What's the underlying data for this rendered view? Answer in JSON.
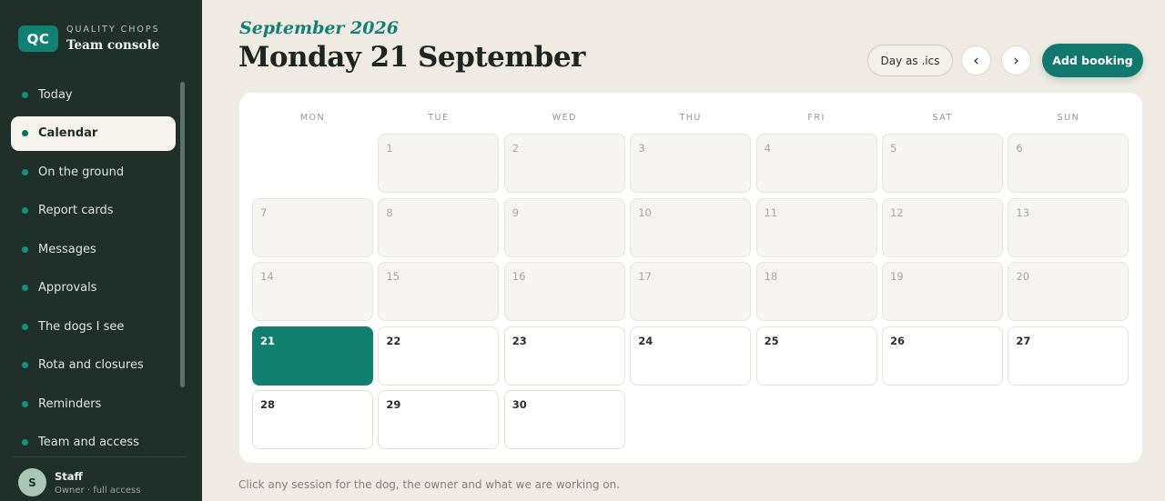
{
  "brand": {
    "logo": "QC",
    "kicker": "QUALITY CHOPS",
    "title": "Team console"
  },
  "nav": [
    {
      "label": "Today",
      "active": false
    },
    {
      "label": "Calendar",
      "active": true
    },
    {
      "label": "On the ground",
      "active": false
    },
    {
      "label": "Report cards",
      "active": false
    },
    {
      "label": "Messages",
      "active": false
    },
    {
      "label": "Approvals",
      "active": false
    },
    {
      "label": "The dogs I see",
      "active": false
    },
    {
      "label": "Rota and closures",
      "active": false
    },
    {
      "label": "Reminders",
      "active": false
    },
    {
      "label": "Team and access",
      "active": false
    }
  ],
  "user": {
    "initial": "S",
    "name": "Staff",
    "role": "Owner · full access"
  },
  "header": {
    "month": "September 2026",
    "title": "Monday 21 September",
    "ics_label": "Day as .ics",
    "prev_label": "‹",
    "next_label": "›",
    "add_label": "Add booking"
  },
  "calendar": {
    "weekdays": [
      "MON",
      "TUE",
      "WED",
      "THU",
      "FRI",
      "SAT",
      "SUN"
    ],
    "first_weekday_index": 1,
    "days_in_month": 30,
    "today": 21
  },
  "footnote": "Click any session for the dog, the owner and what we are working on.",
  "colors": {
    "accent": "#128174",
    "sidebar": "#1f302b",
    "background": "#efebe4"
  }
}
